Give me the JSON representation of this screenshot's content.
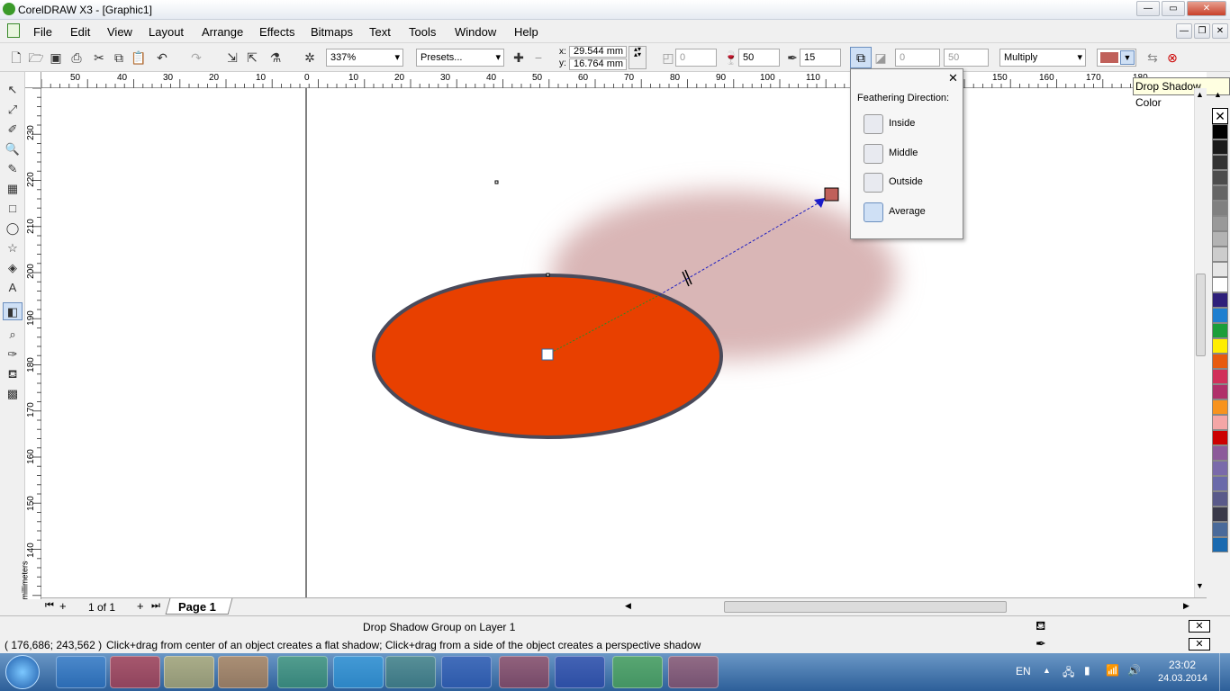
{
  "window": {
    "title": "CorelDRAW X3 - [Graphic1]"
  },
  "menu": [
    "File",
    "Edit",
    "View",
    "Layout",
    "Arrange",
    "Effects",
    "Bitmaps",
    "Text",
    "Tools",
    "Window",
    "Help"
  ],
  "toolbar": {
    "zoom": "337%",
    "presets": "Presets...",
    "x_label": "x:",
    "y_label": "y:",
    "x_value": "29.544 mm",
    "y_value": "16.764 mm",
    "angle_value": "0",
    "opacity_value": "50",
    "feather_value": "15",
    "stretch_value": "0",
    "fade_value": "50",
    "blend_mode": "Multiply",
    "shadow_color": "#c0605a"
  },
  "ruler_top_labels": [
    "50",
    "40",
    "30",
    "20",
    "10",
    "0",
    "10",
    "20",
    "30",
    "40",
    "50",
    "60",
    "70",
    "80",
    "90",
    "100",
    "110",
    "150",
    "160",
    "170",
    "180"
  ],
  "ruler_left_labels": [
    "230",
    "220",
    "210",
    "200",
    "190",
    "180",
    "170",
    "160",
    "150",
    "140"
  ],
  "ruler_unit": "millimeters",
  "popup": {
    "title": "Feathering Direction:",
    "items": [
      "Inside",
      "Middle",
      "Outside",
      "Average"
    ]
  },
  "tooltip": "Drop Shadow Color",
  "pagebar": {
    "page_count": "1 of 1",
    "page_tab": "Page 1"
  },
  "status": {
    "object_info": "Drop Shadow Group on Layer 1",
    "coords": "( 176,686; 243,562 )",
    "hint": "Click+drag from center of an object creates a flat shadow; Click+drag from a side of the object creates a perspective shadow"
  },
  "colors": {
    "ellipse_fill": "#e84000",
    "ellipse_outline": "#4a4a5a",
    "shadow": "#d9b6b6"
  },
  "palette": [
    "#000000",
    "#1a1a1a",
    "#333333",
    "#4d4d4d",
    "#666666",
    "#808080",
    "#999999",
    "#b3b3b3",
    "#cccccc",
    "#e6e6e6",
    "#ffffff",
    "#2e1f7a",
    "#1e7fd0",
    "#1a9e3a",
    "#ffee00",
    "#e85b0f",
    "#d1305a",
    "#b0306a",
    "#f7931e",
    "#f4a6a6",
    "#cc0000",
    "#8c5a9a",
    "#7a6aaa",
    "#6a6aaa",
    "#5a5a8a",
    "#3a3a4a",
    "#4a6a9a",
    "#1a6ab0"
  ],
  "taskbar": {
    "lang": "EN",
    "time": "23:02",
    "date": "24.03.2014"
  }
}
